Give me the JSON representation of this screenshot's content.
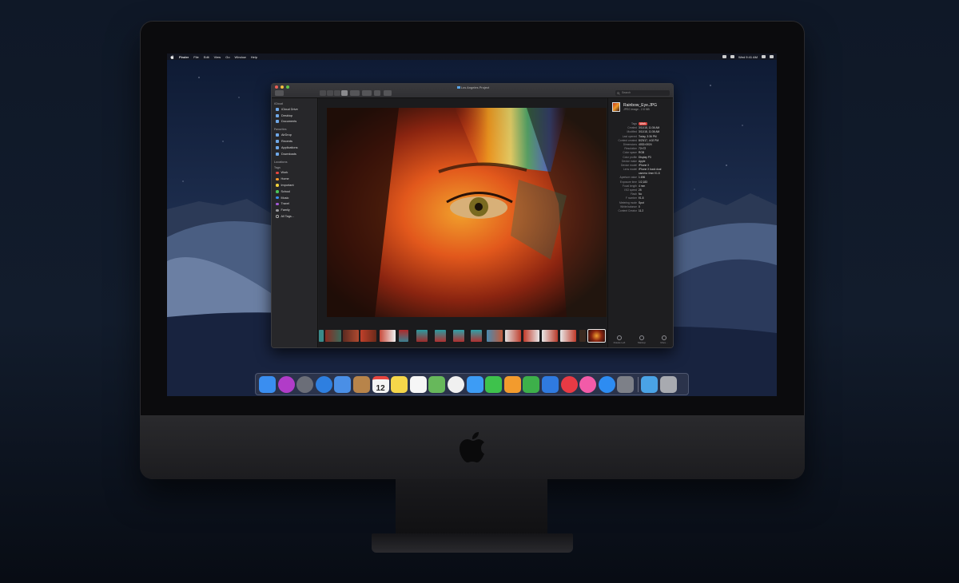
{
  "menubar": {
    "app_name": "Finder",
    "menus": [
      "File",
      "Edit",
      "View",
      "Go",
      "Window",
      "Help"
    ],
    "clock": "Wed 9:41 AM"
  },
  "window": {
    "title": "Los Angeles Project",
    "search_placeholder": "Search"
  },
  "sidebar": {
    "sections": [
      {
        "heading": "iCloud",
        "items": [
          {
            "label": "iCloud Drive",
            "icon": "cloud-icon"
          },
          {
            "label": "Desktop",
            "icon": "desktop-icon"
          },
          {
            "label": "Documents",
            "icon": "documents-icon"
          }
        ]
      },
      {
        "heading": "Favorites",
        "items": [
          {
            "label": "AirDrop",
            "icon": "airdrop-icon"
          },
          {
            "label": "Recents",
            "icon": "clock-icon"
          },
          {
            "label": "Applications",
            "icon": "applications-icon"
          },
          {
            "label": "Downloads",
            "icon": "download-icon"
          }
        ]
      },
      {
        "heading": "Locations",
        "items": []
      },
      {
        "heading": "Tags",
        "items": [
          {
            "label": "Work",
            "color": "#e8463f"
          },
          {
            "label": "Home",
            "color": "#f39a2e"
          },
          {
            "label": "Important",
            "color": "#f2d23c"
          },
          {
            "label": "School",
            "color": "#4bc55a"
          },
          {
            "label": "Music",
            "color": "#3c8ef0"
          },
          {
            "label": "Travel",
            "color": "#a35ad8"
          },
          {
            "label": "Family",
            "color": "#9a9a9e"
          },
          {
            "label": "All Tags...",
            "color": "outline"
          }
        ]
      }
    ]
  },
  "inspector": {
    "file_name": "Rainbow_Eye.JPG",
    "file_kind": "JPEG image - 2.8 MB",
    "rows": [
      {
        "key": "Tags",
        "value": "Work",
        "pill": true
      },
      {
        "key": "Created",
        "value": "3/11/18, 11:36 AM"
      },
      {
        "key": "Modified",
        "value": "3/11/18, 11:36 AM"
      },
      {
        "key": "Last opened",
        "value": "Today, 3:36 PM"
      },
      {
        "key": "Content created",
        "value": "8/23/17, 4:02 PM"
      },
      {
        "key": "Dimensions",
        "value": "4032×3024"
      },
      {
        "key": "Resolution",
        "value": "72×72"
      },
      {
        "key": "Color space",
        "value": "RGB"
      },
      {
        "key": "Color profile",
        "value": "Display P3"
      },
      {
        "key": "Device make",
        "value": "Apple"
      },
      {
        "key": "Device model",
        "value": "iPhone X"
      },
      {
        "key": "Lens model",
        "value": "iPhone X back dual"
      },
      {
        "key": "",
        "value": "camera 4mm f/1.8"
      },
      {
        "key": "Aperture value",
        "value": "1.696"
      },
      {
        "key": "Exposure time",
        "value": "1/2,183"
      },
      {
        "key": "Focal length",
        "value": "4 mm"
      },
      {
        "key": "ISO speed",
        "value": "25"
      },
      {
        "key": "Flash",
        "value": "No"
      },
      {
        "key": "F number",
        "value": "f/1.8"
      },
      {
        "key": "Metering mode",
        "value": "Spot"
      },
      {
        "key": "White balance",
        "value": "0"
      },
      {
        "key": "Content Creator",
        "value": "11.2"
      }
    ],
    "actions": [
      "Rotate Left",
      "Markup",
      "More..."
    ]
  },
  "dock": {
    "apps": [
      {
        "name": "finder-icon",
        "color": "#3a8ef0"
      },
      {
        "name": "siri-icon",
        "color": "#b13cc8"
      },
      {
        "name": "launchpad-icon",
        "color": "#6b6e78"
      },
      {
        "name": "safari-icon",
        "color": "#2e7fe0"
      },
      {
        "name": "mail-icon",
        "color": "#4a8fe6"
      },
      {
        "name": "contacts-icon",
        "color": "#b8844a"
      },
      {
        "name": "calendar-icon",
        "color": "#f4f4f4"
      },
      {
        "name": "notes-icon",
        "color": "#f5d64a"
      },
      {
        "name": "reminders-icon",
        "color": "#f6f6f6"
      },
      {
        "name": "maps-icon",
        "color": "#67b85b"
      },
      {
        "name": "photos-icon",
        "color": "#f0f0f0"
      },
      {
        "name": "messages-icon",
        "color": "#3d9cf5"
      },
      {
        "name": "facetime-icon",
        "color": "#3ec24c"
      },
      {
        "name": "pages-icon",
        "color": "#f39b2d"
      },
      {
        "name": "numbers-icon",
        "color": "#3db04a"
      },
      {
        "name": "keynote-icon",
        "color": "#2f7ae0"
      },
      {
        "name": "news-icon",
        "color": "#e83a44"
      },
      {
        "name": "itunes-icon",
        "color": "#f25ba8"
      },
      {
        "name": "app-store-icon",
        "color": "#2d8cf2"
      },
      {
        "name": "system-preferences-icon",
        "color": "#7d8088"
      },
      {
        "name": "downloads-folder-icon",
        "color": "#4aa3e6"
      },
      {
        "name": "trash-icon",
        "color": "#a8aab0"
      }
    ],
    "calendar_day": "12"
  }
}
